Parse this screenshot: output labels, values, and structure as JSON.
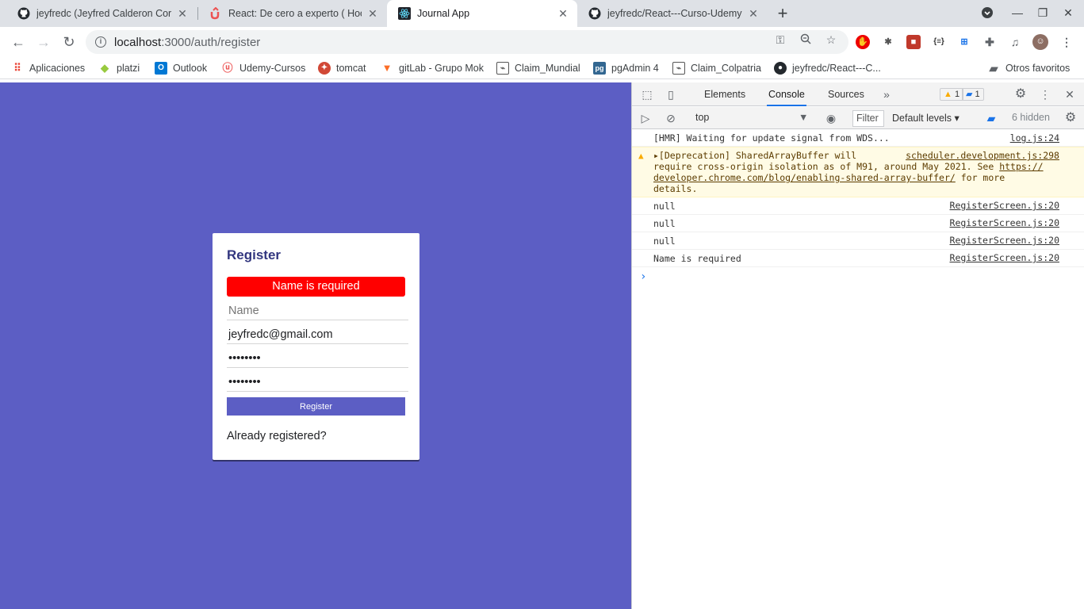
{
  "tabs": [
    {
      "title": "jeyfredc (Jeyfred Calderon Corte",
      "favicon": "github-icon"
    },
    {
      "title": "React: De cero a experto ( Hook",
      "favicon": "udemy-icon"
    },
    {
      "title": "Journal App",
      "favicon": "react-icon"
    },
    {
      "title": "jeyfredc/React---Curso-Udemy",
      "favicon": "github-icon"
    }
  ],
  "omnibox": {
    "host": "localhost",
    "path": ":3000/auth/register"
  },
  "bookmarks": [
    "Aplicaciones",
    "platzi",
    "Outlook",
    "Udemy-Cursos",
    "tomcat",
    "gitLab - Grupo Mok",
    "Claim_Mundial",
    "pgAdmin 4",
    "Claim_Colpatria",
    "jeyfredc/React---C...",
    "Otros favoritos"
  ],
  "register": {
    "title": "Register",
    "error": "Name is required",
    "name_placeholder": "Name",
    "email_value": "jeyfredc@gmail.com",
    "password_value": "••••••••",
    "password2_value": "••••••••",
    "button": "Register",
    "link": "Already registered?"
  },
  "devtools": {
    "tabs": [
      "Elements",
      "Console",
      "Sources"
    ],
    "warnings": "1",
    "messages": "1",
    "context": "top",
    "filter": "Filter",
    "levels": "Default levels",
    "hidden": "6 hidden",
    "logs": [
      {
        "text": "[HMR] Waiting for update signal from WDS...",
        "src": "log.js:24"
      },
      {
        "src": "scheduler.development.js:298",
        "text1": "▸[Deprecation] SharedArrayBuffer will",
        "text2": "require cross-origin isolation as of M91, around May 2021. See ",
        "link1": "https://",
        "link2": "developer.chrome.com/blog/enabling-shared-array-buffer/",
        "text3": " for more",
        "text4": "details."
      },
      {
        "text": "null",
        "src": "RegisterScreen.js:20"
      },
      {
        "text": "null",
        "src": "RegisterScreen.js:20"
      },
      {
        "text": "null",
        "src": "RegisterScreen.js:20"
      },
      {
        "text": "Name is required",
        "src": "RegisterScreen.js:20"
      }
    ]
  },
  "colors": {
    "page_bg": "#5c5ec4",
    "error_bg": "#ff0000",
    "title": "#32367f"
  }
}
